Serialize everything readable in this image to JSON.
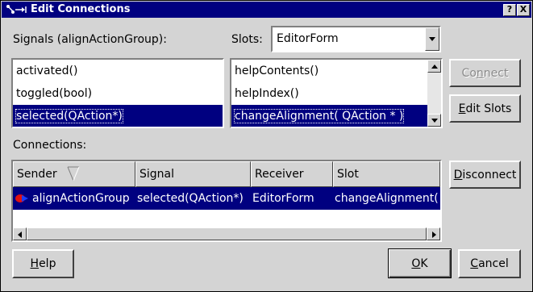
{
  "window": {
    "title": "Edit Connections",
    "app_icon": "∡→⩏",
    "help_btn": "?",
    "close_btn": "X"
  },
  "signals": {
    "label": "Signals (alignActionGroup):",
    "items": [
      "activated()",
      "toggled(bool)",
      "selected(QAction*)"
    ],
    "selected_index": 2
  },
  "slots": {
    "label": "Slots:",
    "combo_value": "EditorForm",
    "items": [
      "helpContents()",
      "helpIndex()",
      "changeAlignment( QAction * )"
    ],
    "selected_index": 2
  },
  "buttons": {
    "connect_pre": "Co",
    "connect_u": "n",
    "connect_post": "nect",
    "editslots_pre": "",
    "editslots_u": "E",
    "editslots_post": "dit Slots",
    "disconnect_pre": "",
    "disconnect_u": "D",
    "disconnect_post": "isconnect",
    "help_pre": "",
    "help_u": "H",
    "help_post": "elp",
    "ok_pre": "",
    "ok_u": "O",
    "ok_post": "K",
    "cancel_pre": "",
    "cancel_u": "C",
    "cancel_post": "ancel"
  },
  "connections": {
    "label": "Connections:",
    "columns": [
      "Sender",
      "Signal",
      "Receiver",
      "Slot"
    ],
    "rows": [
      {
        "sender": "alignActionGroup",
        "signal": "selected(QAction*)",
        "receiver": "EditorForm",
        "slot": "changeAlignment("
      }
    ]
  },
  "colors": {
    "selection": "#000080",
    "face": "#d4d4d4",
    "sender_icon": "#e01010"
  },
  "icons": {
    "sender": "action-group-icon",
    "sort": "sort-indicator-icon"
  }
}
